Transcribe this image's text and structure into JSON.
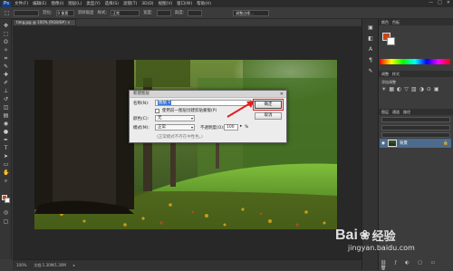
{
  "menubar": {
    "logo": "Ps",
    "items": [
      "文件(F)",
      "编辑(E)",
      "图像(I)",
      "图层(L)",
      "类型(Y)",
      "选择(S)",
      "滤镜(T)",
      "3D(D)",
      "视图(V)",
      "窗口(W)",
      "帮助(H)"
    ],
    "controls": [
      "—",
      "□",
      "✕"
    ]
  },
  "optionsbar": {
    "labels": [
      "羽化:",
      "0 像素",
      "消除锯齿",
      "样式:",
      "正常",
      "宽度:",
      "高度:",
      "调整边缘..."
    ]
  },
  "document": {
    "tab_label": "timg.jpg @ 100% (RGB/8#) ×"
  },
  "statusbar": {
    "zoom": "100%",
    "doc_size": "文档:1.30M/1.30M"
  },
  "panels": {
    "top_tabs": [
      "颜色",
      "色板"
    ],
    "mid_tabs": [
      "调整",
      "样式"
    ],
    "mid_label": "添加调整",
    "layer_tabs": [
      "图层",
      "通道",
      "路径"
    ],
    "layer_name": "背景"
  },
  "dialog": {
    "title": "新建图层",
    "close": "✕",
    "name_label": "名称(N):",
    "name_value": "图层 1",
    "checkbox_label": "使用前一图层创建剪贴蒙版(P)",
    "color_label": "颜色(C):",
    "color_value": "无",
    "mode_label": "模式(M):",
    "mode_value": "正常",
    "opacity_label": "不透明度(O):",
    "opacity_value": "100",
    "opacity_unit": "%",
    "note": "(正常模式不存在中性色。)",
    "ok_label": "确定",
    "cancel_label": "取消"
  },
  "watermark": {
    "brand": "Bai",
    "brand2": "经验",
    "url": "jingyan.baidu.com"
  },
  "colors": {
    "highlight": "#e02020",
    "foreground": "#c2471b",
    "layer_selected": "#4d6b8c"
  }
}
